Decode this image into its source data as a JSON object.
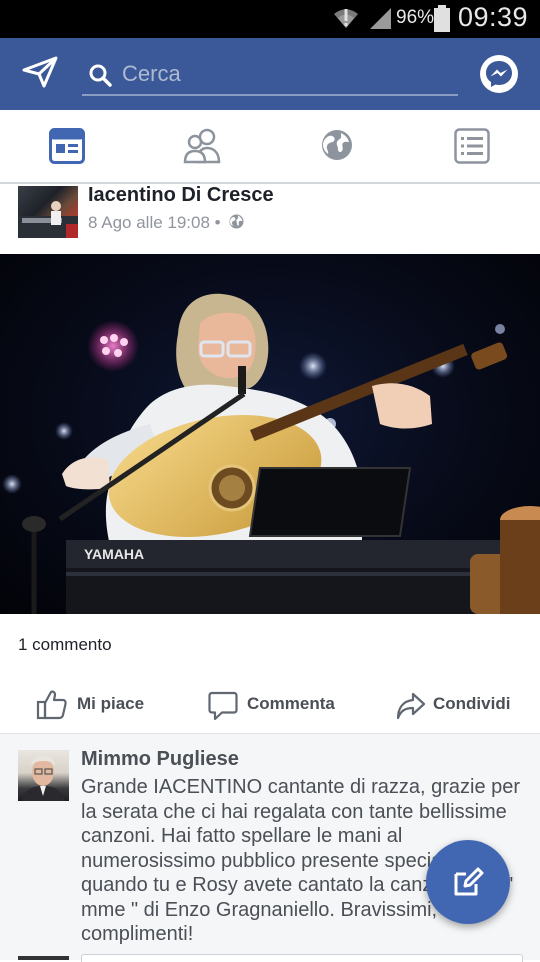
{
  "status_bar": {
    "battery_percent": "96%",
    "time": "09:39",
    "icons": [
      "wifi-icon",
      "signal-icon",
      "battery-icon"
    ]
  },
  "top_bar": {
    "search_placeholder": "Cerca",
    "left_icon": "send-icon",
    "right_icon": "messenger-icon",
    "bar_color": "#3b5998"
  },
  "tabs": [
    {
      "icon": "news-feed-icon",
      "active": true
    },
    {
      "icon": "friends-icon",
      "active": false
    },
    {
      "icon": "globe-icon",
      "active": false
    },
    {
      "icon": "menu-list-icon",
      "active": false
    }
  ],
  "post": {
    "author": "Iacentino Di Cresce",
    "meta": "8 Ago alle 19:08 •",
    "privacy_icon": "globe-small-icon",
    "photo_description_icon": "concert-photo",
    "keyboard_brand": "YAMAHA",
    "comment_count": "1 commento",
    "actions": {
      "like": "Mi piace",
      "comment": "Commenta",
      "share": "Condividi"
    }
  },
  "comments": [
    {
      "author": "Mimmo Pugliese",
      "text": "Grande IACENTINO cantante di razza, grazie per la serata che ci hai regalata con tante bellissime canzoni. Hai fatto spellare le mani al numerosissimo pubblico presente specialmente quando tu e Rosy avete cantato la canzone \"Cu ' mme \" di Enzo Gragnaniello. Bravissimi, complimenti!"
    }
  ],
  "fab": {
    "icon": "compose-icon",
    "color": "#4267b2"
  }
}
